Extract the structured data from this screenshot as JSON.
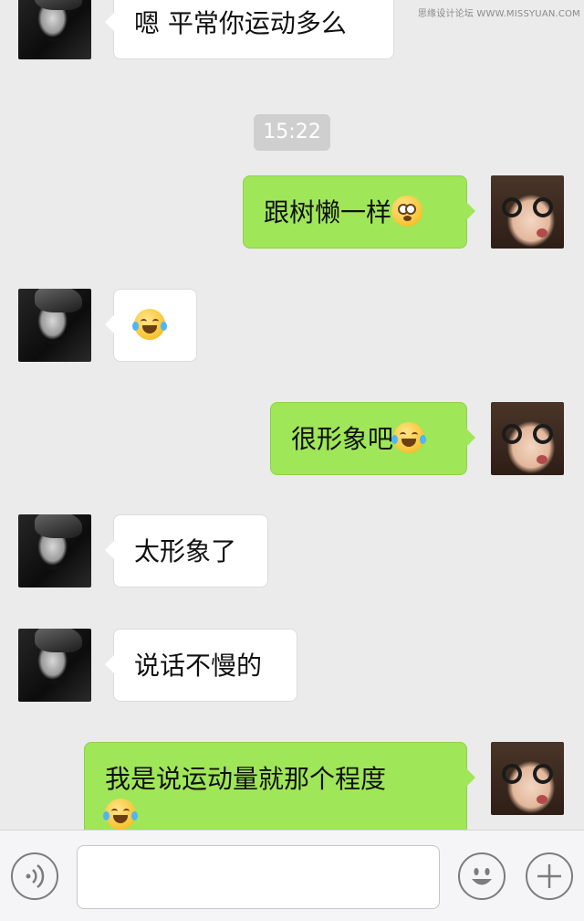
{
  "watermark": "思缘设计论坛 WWW.MISSYUAN.COM",
  "timestamp": "15:22",
  "messages": [
    {
      "text": "嗯 平常你运动多么"
    },
    {
      "text": "跟树懒一样"
    },
    {
      "text": ""
    },
    {
      "text": "很形象吧"
    },
    {
      "text": "太形象了"
    },
    {
      "text": "说话不慢的"
    },
    {
      "text": "我是说运动量就那个程度"
    }
  ],
  "icons": {
    "woozy": "woozy-face-emoji",
    "laughing": "face-with-tears-of-joy-emoji",
    "voice": "voice-icon",
    "emoji": "emoji-icon",
    "plus": "plus-icon"
  },
  "colors": {
    "background": "#ebebeb",
    "outgoing_bubble": "#9fe659",
    "incoming_bubble": "#ffffff",
    "timestamp_bg": "#cfcfcf"
  },
  "input": {
    "value": ""
  }
}
